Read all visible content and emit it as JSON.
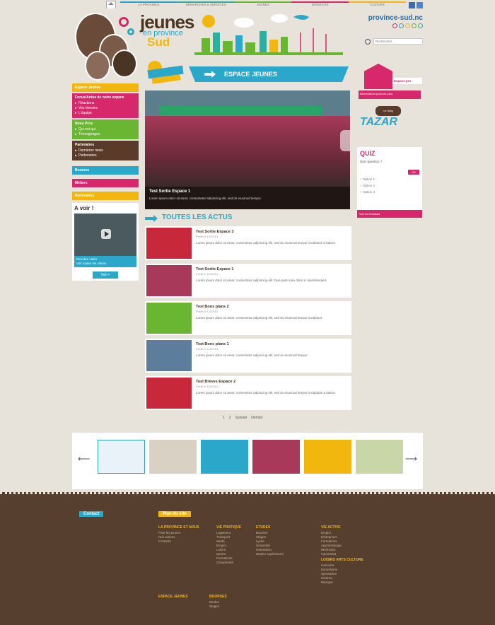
{
  "topnav": {
    "items": [
      "La Province",
      "Démarches & services",
      "Jeunes",
      "Diversité",
      "Culture"
    ]
  },
  "header": {
    "logo_line1": "jeunes",
    "logo_line2": "en province",
    "logo_line3": "Sud",
    "province_site": "province-sud.nc",
    "search_placeholder": "Rechercher"
  },
  "sidebar": {
    "espace": "Espace Jeunes",
    "blocks": [
      {
        "title": "Focus/Actus de notre espace",
        "items": [
          "Réactions",
          "Vos témoins",
          "L'équipe"
        ],
        "color": "#d6286b"
      },
      {
        "title": "Nous Pros",
        "items": [
          "Qui est qui",
          "Témoignages"
        ],
        "color": "#6ab531"
      },
      {
        "title": "Partenaires",
        "items": [
          "Dernières news",
          "Partenaires"
        ],
        "color": "#5a3b2a"
      }
    ],
    "links": [
      {
        "label": "Bourses",
        "color": "#2aa7c9"
      },
      {
        "label": "Métiers",
        "color": "#d6286b"
      },
      {
        "label": "Partenaires",
        "color": "#f2b70f"
      }
    ],
    "avoir": {
      "title": "A voir !",
      "caption": "Dernière vidéo",
      "more": "Voir toutes les vidéos",
      "button": "Voir +"
    }
  },
  "main": {
    "espace_label": "ESPACE JEUNES",
    "slide": {
      "title": "Test Sortie Espace 1",
      "desc": "Lorem ipsum dolor sit amet, consectetur adipiscing elit, sed do eiusmod tempor."
    },
    "actus_title": "TOUTES LES ACTUS",
    "news": [
      {
        "title": "Test Sortie Espace 3",
        "date": "Posté le 12/02/14",
        "excerpt": "Lorem ipsum dolor sit amet, consectetur adipiscing elit, sed do eiusmod tempor incididunt ut labore.",
        "color": "#c7283a"
      },
      {
        "title": "Test Sortie Espace 1",
        "date": "Posté le 12/02/14",
        "excerpt": "Lorem ipsum dolor sit amet, consectetur adipiscing elit. Duis aute irure dolor in reprehenderit.",
        "color": "#a8395a"
      },
      {
        "title": "Test Bons plans 2",
        "date": "Posté le 12/02/14",
        "excerpt": "Lorem ipsum dolor sit amet, consectetur adipiscing elit, sed do eiusmod tempor incididunt.",
        "color": "#6ab531"
      },
      {
        "title": "Test Bons plans 1",
        "date": "Posté le 12/02/14",
        "excerpt": "Lorem ipsum dolor sit amet, consectetur adipiscing elit, sed do eiusmod tempor.",
        "color": "#5c7d9c"
      },
      {
        "title": "Test Brèves Espace 2",
        "date": "Posté le 12/02/14",
        "excerpt": "Lorem ipsum dolor sit amet, consectetur adipiscing elit, sed do eiusmod tempor incididunt ut labore.",
        "color": "#c7283a"
      }
    ],
    "pager": [
      "1",
      "2",
      "Suivant",
      "Dernier"
    ]
  },
  "right": {
    "espace_pro": "Espace pro",
    "espace_sub": "Informations pour les pros",
    "tazar_badge": "Le mag",
    "tazar": "TAZAR",
    "quiz": {
      "title": "QUIZ",
      "question": "Quiz question ?",
      "ok": "OK",
      "options": [
        "Option 1",
        "Option 2",
        "Option 3"
      ],
      "footer": "Voir les résultats"
    }
  },
  "carousel": {
    "colors": [
      "#e8f2f8",
      "#d9d2c4",
      "#2aa7c9",
      "#a8395a",
      "#f2b70f",
      "#c9d6a8"
    ]
  },
  "footer": {
    "contact": "Contact",
    "plan": "Plan du site",
    "cols": [
      {
        "title": "LA PROVINCE ET NOUS",
        "items": [
          "Pour les jeunes",
          "Nos actions",
          "Contacts"
        ]
      },
      {
        "title": "VIE PRATIQUE",
        "items": [
          "Logement",
          "Transport",
          "Santé",
          "Emploi",
          "Loisirs",
          "Sports",
          "Formations",
          "Citoyenneté"
        ]
      },
      {
        "title": "ETUDES",
        "items": [
          "Bourses",
          "Stages",
          "Lycée",
          "Université",
          "Orientation",
          "Etudes supérieures"
        ]
      },
      {
        "title": "VIE ACTIVE",
        "items": [
          "Emploi",
          "Entreprises",
          "Formations",
          "Apprentissage",
          "Bénévolat",
          "Volontariat"
        ]
      }
    ],
    "culture_title": "LOISIRS ARTS CULTURE",
    "culture_items": [
      "Concerts",
      "Expositions",
      "Spectacles",
      "Cinéma",
      "Musique"
    ],
    "bottom_left": "ESPACE JEUNES",
    "bottom_mid": "BOURSES",
    "bottom_items": [
      "Etudes",
      "Stages"
    ]
  }
}
